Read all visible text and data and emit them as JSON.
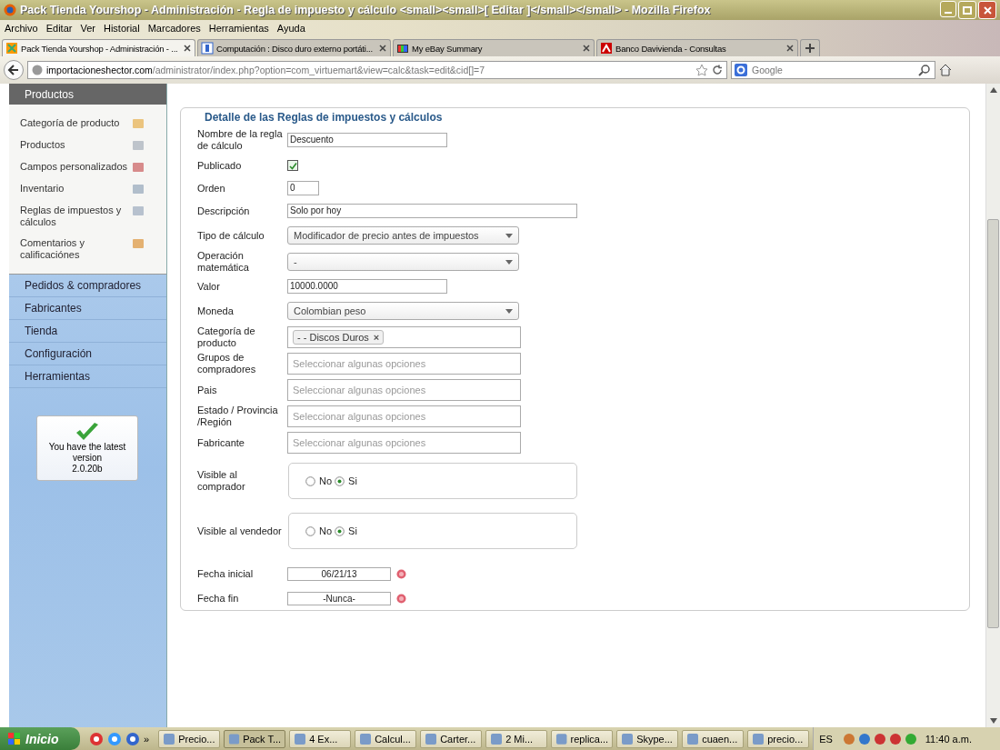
{
  "window": {
    "title": "Pack Tienda Yourshop - Administración - Regla de impuesto y cálculo <small><small>[ Editar ]</small></small> - Mozilla Firefox"
  },
  "menu": [
    "Archivo",
    "Editar",
    "Ver",
    "Historial",
    "Marcadores",
    "Herramientas",
    "Ayuda"
  ],
  "tabs": [
    {
      "label": "Pack Tienda Yourshop - Administración - ...",
      "selected": true
    },
    {
      "label": "Computación : Disco duro externo portáti...",
      "selected": false
    },
    {
      "label": "My eBay Summary",
      "selected": false
    },
    {
      "label": "Banco Davivienda - Consultas",
      "selected": false
    }
  ],
  "address": {
    "host": "importacioneshector.com",
    "path": "/administrator/index.php?option=com_virtuemart&view=calc&task=edit&cid[]=7"
  },
  "search": {
    "placeholder": "Google"
  },
  "sidebar": {
    "header": "Productos",
    "items": [
      {
        "label": "Categoría de producto"
      },
      {
        "label": "Productos"
      },
      {
        "label": "Campos personalizados"
      },
      {
        "label": "Inventario"
      },
      {
        "label": "Reglas de impuestos y cálculos"
      },
      {
        "label": "Comentarios y calificaciónes"
      }
    ],
    "sections": [
      "Pedidos & compradores",
      "Fabricantes",
      "Tienda",
      "Configuración",
      "Herramientas"
    ],
    "version_box": {
      "message": "You have the latest version",
      "version": "2.0.20b"
    }
  },
  "form": {
    "legend": "Detalle de las Reglas de impuestos y cálculos",
    "fields": [
      {
        "kind": "text",
        "label": "Nombre de la regla de cálculo",
        "value": "Descuento"
      },
      {
        "kind": "checkbox",
        "label": "Publicado",
        "checked": true
      },
      {
        "kind": "short",
        "label": "Orden",
        "value": "0"
      },
      {
        "kind": "long",
        "label": "Descripción",
        "value": "Solo por hoy"
      },
      {
        "kind": "select",
        "label": "Tipo de cálculo",
        "value": "Modificador de precio antes de impuestos"
      },
      {
        "kind": "select",
        "label": "Operación matemática",
        "value": "-"
      },
      {
        "kind": "text",
        "label": "Valor",
        "value": "10000.0000"
      },
      {
        "kind": "select",
        "label": "Moneda",
        "value": "Colombian peso"
      },
      {
        "kind": "multiselect",
        "label": "Categoría de producto",
        "chips": [
          "- - Discos Duros"
        ],
        "remove": "×"
      },
      {
        "kind": "multiselect",
        "label": "Grupos de compradores",
        "placeholder": "Seleccionar algunas opciones"
      },
      {
        "kind": "multiselect",
        "label": "Pais",
        "placeholder": "Seleccionar algunas opciones"
      },
      {
        "kind": "multiselect",
        "label": "Estado / Provincia /Región",
        "placeholder": "Seleccionar algunas opciones"
      },
      {
        "kind": "multiselect",
        "label": "Fabricante",
        "placeholder": "Seleccionar algunas opciones"
      },
      {
        "kind": "radio",
        "label": "Visible al comprador",
        "options": [
          {
            "label": "No",
            "selected": false
          },
          {
            "label": "Si",
            "selected": true
          }
        ]
      },
      {
        "kind": "radio",
        "label": "Visible al vendedor",
        "options": [
          {
            "label": "No",
            "selected": false
          },
          {
            "label": "Si",
            "selected": true
          }
        ]
      },
      {
        "kind": "date",
        "label": "Fecha inicial",
        "value": "06/21/13"
      },
      {
        "kind": "date",
        "label": "Fecha fin",
        "value": "-Nunca-"
      }
    ]
  },
  "taskbar": {
    "start": "Inicio",
    "more": "»",
    "buttons": [
      {
        "label": "Precio...",
        "selected": false
      },
      {
        "label": "Pack T...",
        "selected": true
      },
      {
        "label": "4 Ex...",
        "selected": false
      },
      {
        "label": "Calcul...",
        "selected": false
      },
      {
        "label": "Carter...",
        "selected": false
      },
      {
        "label": "2 Mi...",
        "selected": false
      },
      {
        "label": "replica...",
        "selected": false
      },
      {
        "label": "Skype...",
        "selected": false
      },
      {
        "label": "cuaen...",
        "selected": false
      },
      {
        "label": "precio...",
        "selected": false
      }
    ],
    "language": "ES",
    "clock": "11:40 a.m."
  }
}
